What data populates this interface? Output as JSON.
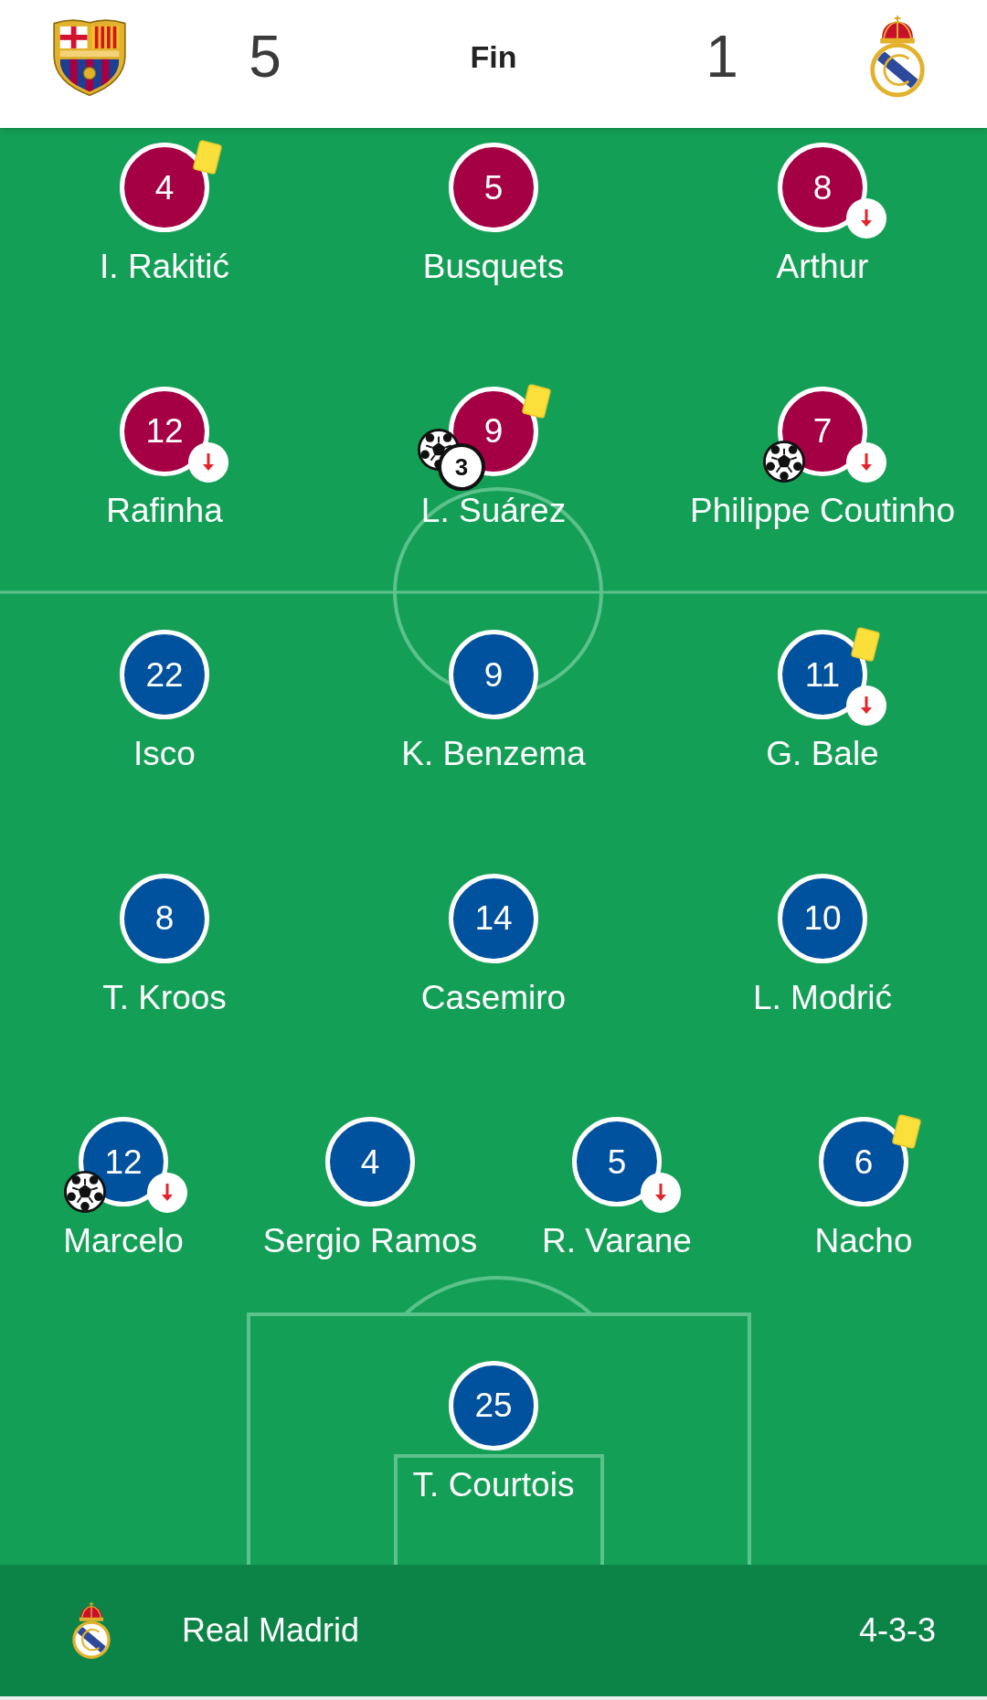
{
  "header": {
    "home_score": "5",
    "status": "Fin",
    "away_score": "1"
  },
  "pitch": {
    "teams": [
      {
        "color": "#a50044",
        "lines": [
          [
            {
              "number": "4",
              "name": "I. Rakitić",
              "yellow_card": true,
              "substituted": false,
              "scored": false
            },
            {
              "number": "5",
              "name": "Busquets",
              "yellow_card": false,
              "substituted": false,
              "scored": false
            },
            {
              "number": "8",
              "name": "Arthur",
              "yellow_card": false,
              "substituted": true,
              "scored": false
            }
          ],
          [
            {
              "number": "12",
              "name": "Rafinha",
              "yellow_card": false,
              "substituted": true,
              "scored": false
            },
            {
              "number": "9",
              "name": "L. Suárez",
              "yellow_card": true,
              "substituted": false,
              "scored": true,
              "goal_count": "3"
            },
            {
              "number": "7",
              "name": "Philippe Coutinho",
              "yellow_card": false,
              "substituted": true,
              "scored": true
            }
          ]
        ]
      },
      {
        "color": "#00529f",
        "lines": [
          [
            {
              "number": "22",
              "name": "Isco",
              "yellow_card": false,
              "substituted": false,
              "scored": false
            },
            {
              "number": "9",
              "name": "K. Benzema",
              "yellow_card": false,
              "substituted": false,
              "scored": false
            },
            {
              "number": "11",
              "name": "G. Bale",
              "yellow_card": true,
              "substituted": true,
              "scored": false
            }
          ],
          [
            {
              "number": "8",
              "name": "T. Kroos",
              "yellow_card": false,
              "substituted": false,
              "scored": false
            },
            {
              "number": "14",
              "name": "Casemiro",
              "yellow_card": false,
              "substituted": false,
              "scored": false
            },
            {
              "number": "10",
              "name": "L. Modrić",
              "yellow_card": false,
              "substituted": false,
              "scored": false
            }
          ],
          [
            {
              "number": "12",
              "name": "Marcelo",
              "yellow_card": false,
              "substituted": true,
              "scored": true
            },
            {
              "number": "4",
              "name": "Sergio Ramos",
              "yellow_card": false,
              "substituted": false,
              "scored": false
            },
            {
              "number": "5",
              "name": "R. Varane",
              "yellow_card": false,
              "substituted": true,
              "scored": false
            },
            {
              "number": "6",
              "name": "Nacho",
              "yellow_card": true,
              "substituted": false,
              "scored": false
            }
          ],
          [
            {
              "number": "25",
              "name": "T. Courtois",
              "yellow_card": false,
              "substituted": false,
              "scored": false
            }
          ]
        ]
      }
    ]
  },
  "team_bar": {
    "team": "Real Madrid",
    "formation": "4-3-3"
  }
}
